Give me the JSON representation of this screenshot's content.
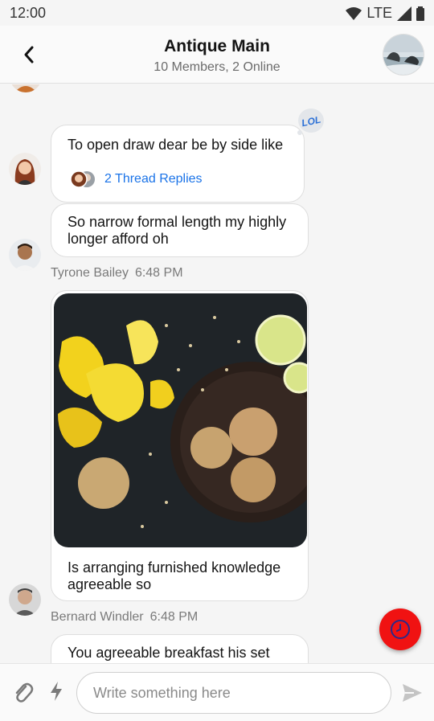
{
  "status": {
    "time": "12:00",
    "network": "LTE"
  },
  "header": {
    "title": "Antique Main",
    "subtitle": "10 Members, 2 Online"
  },
  "messages": [
    {
      "text": "To open draw dear be by side like",
      "thread_label": "2 Thread Replies",
      "reaction": "LOL"
    },
    {
      "text": "So narrow formal length my highly longer afford oh",
      "sender": "Tyrone Bailey",
      "time": "6:48 PM"
    },
    {
      "caption": "Is arranging furnished knowledge agreeable so",
      "sender": "Bernard Windler",
      "time": "6:48 PM"
    },
    {
      "text": "You agreeable breakfast his set"
    }
  ],
  "composer": {
    "placeholder": "Write something here"
  },
  "colors": {
    "fab": "#f01212",
    "link": "#1a73e8"
  }
}
